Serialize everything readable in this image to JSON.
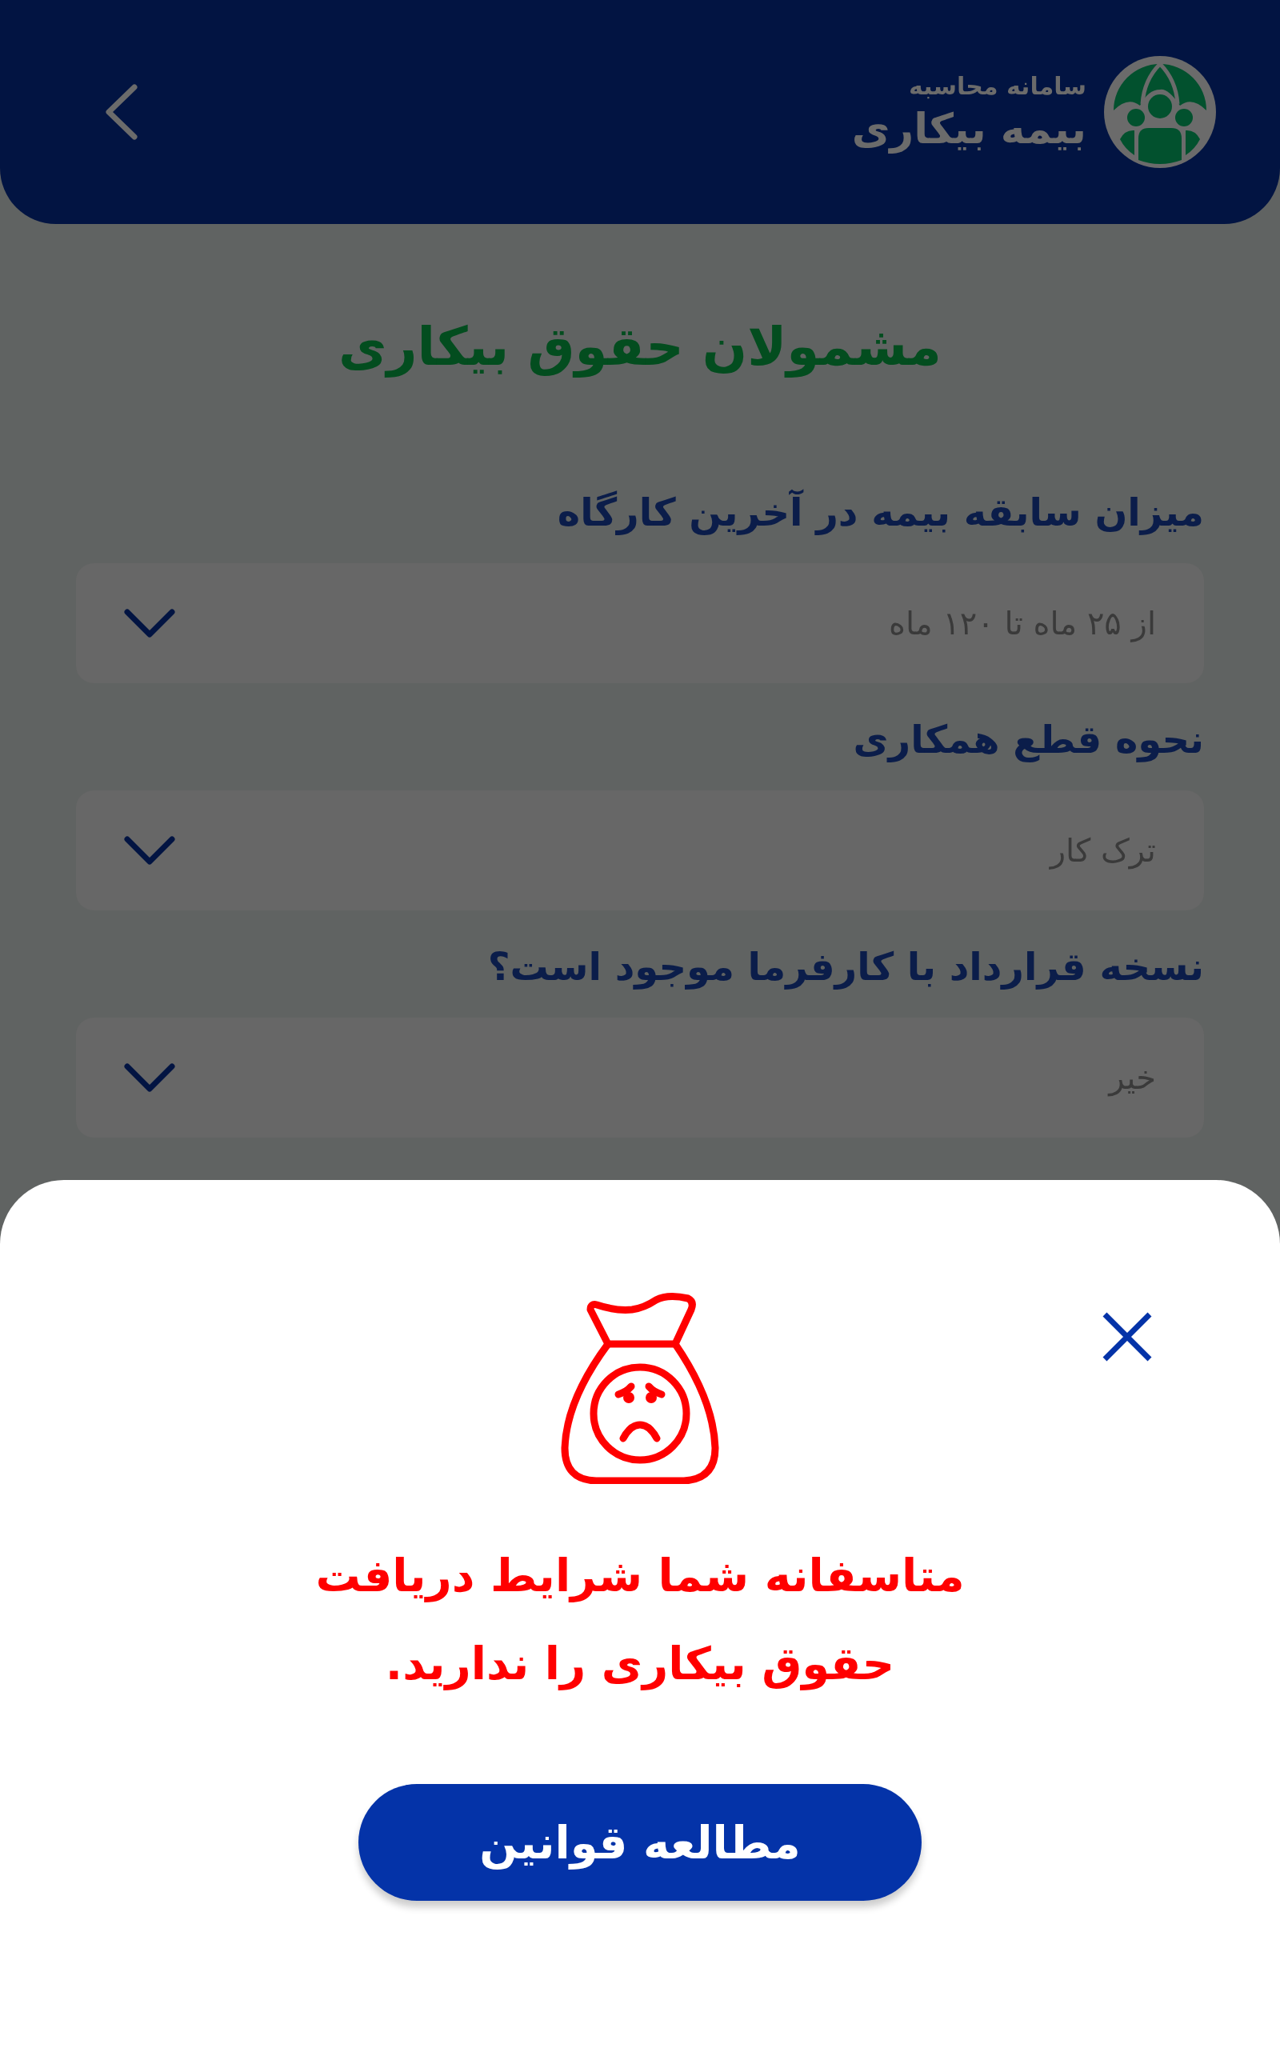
{
  "header": {
    "subtitle": "سامانه محاسبه",
    "title": "بیمه بیکاری"
  },
  "page_title": "مشمولان حقوق بیکاری",
  "fields": [
    {
      "label": "میزان سابقه بیمه در آخرین کارگاه",
      "value": "از ۲۵ ماه تا ۱۲۰ ماه"
    },
    {
      "label": "نحوه قطع همکاری",
      "value": "ترک کار"
    },
    {
      "label": "نسخه قرارداد با کارفرما موجود است؟",
      "value": "خیر"
    }
  ],
  "dialog": {
    "message_lines": [
      "متاسفانه شما شرایط دریافت",
      "حقوق بیکاری را ندارید."
    ],
    "button": "مطالعه قوانین"
  }
}
